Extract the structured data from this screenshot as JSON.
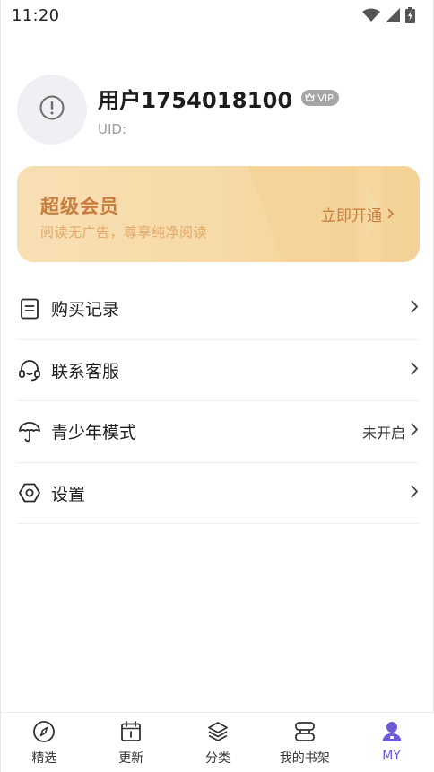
{
  "status_bar": {
    "time": "11:20",
    "icons": [
      "wifi-icon",
      "cellular-signal-icon",
      "battery-charging-icon"
    ]
  },
  "profile": {
    "username": "用户1754018100",
    "vip_badge": "VIP",
    "uid_label": "UID:",
    "avatar_icon": "alert-circle-icon"
  },
  "vip_card": {
    "title": "超级会员",
    "subtitle": "阅读无广告，尊享纯净阅读",
    "cta": "立即开通",
    "colors": {
      "title": "#c87d3e",
      "subtitle": "#e3a96a",
      "background": "#f7dba8"
    }
  },
  "menu": {
    "items": [
      {
        "label": "购买记录",
        "icon": "receipt-icon",
        "value": ""
      },
      {
        "label": "联系客服",
        "icon": "headset-icon",
        "value": ""
      },
      {
        "label": "青少年模式",
        "icon": "umbrella-icon",
        "value": "未开启"
      },
      {
        "label": "设置",
        "icon": "settings-hexagon-icon",
        "value": ""
      }
    ]
  },
  "bottom_nav": {
    "active_color": "#6b5bd6",
    "items": [
      {
        "label": "精选",
        "icon": "compass-icon"
      },
      {
        "label": "更新",
        "icon": "calendar-icon"
      },
      {
        "label": "分类",
        "icon": "layers-icon"
      },
      {
        "label": "我的书架",
        "icon": "bookshelf-icon"
      },
      {
        "label": "MY",
        "icon": "user-icon",
        "active": true
      }
    ]
  }
}
